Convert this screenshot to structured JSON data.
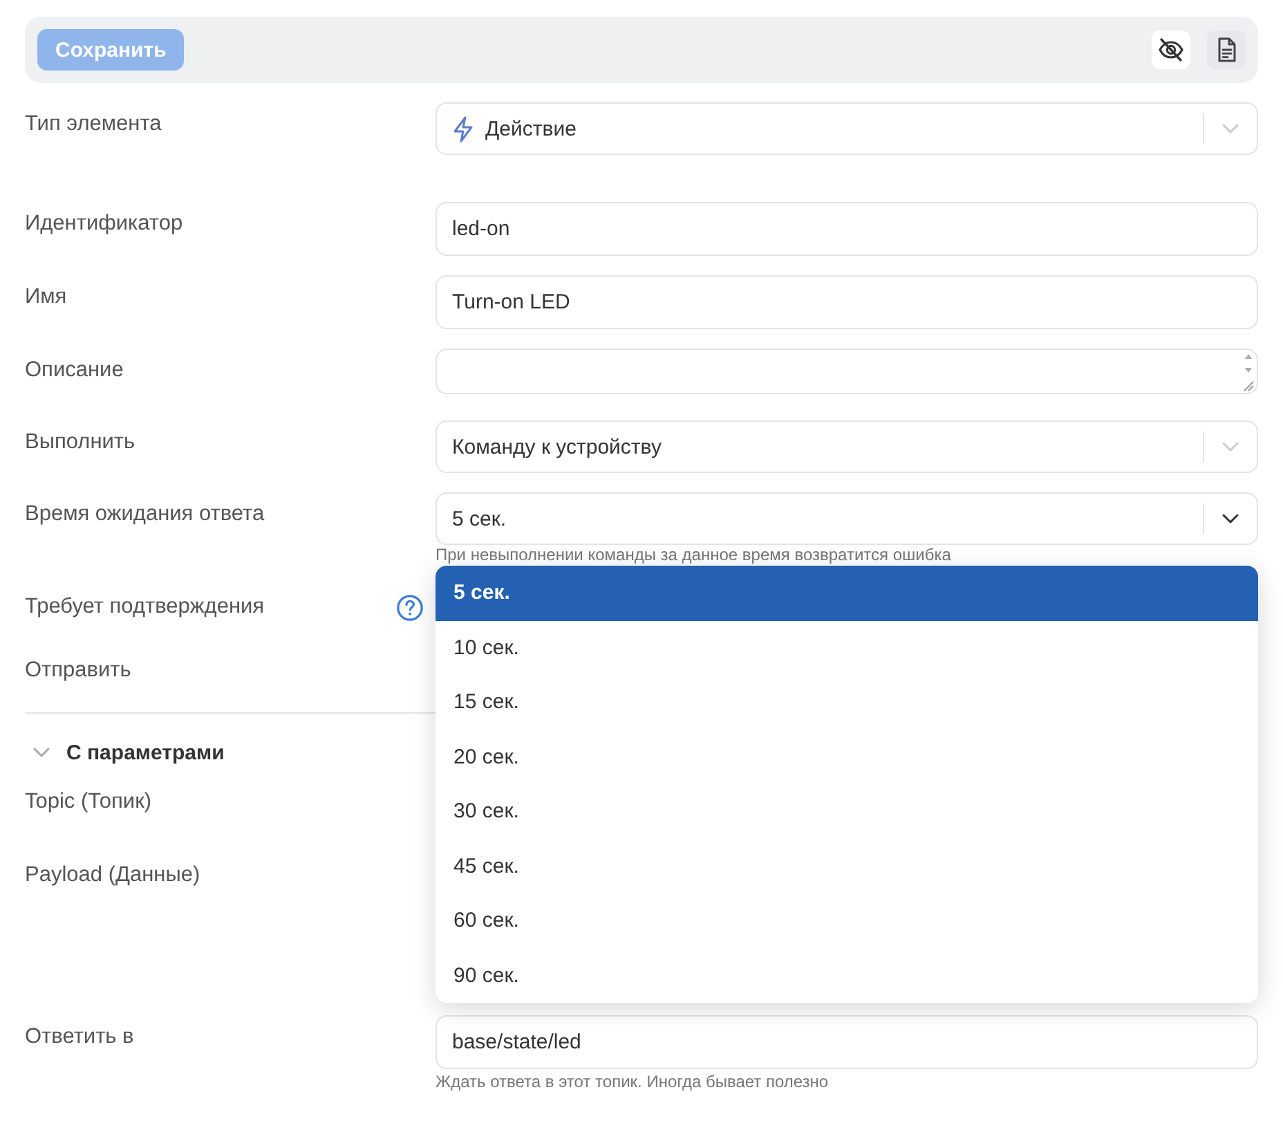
{
  "toolbar": {
    "save_button": {
      "label": "Сохранить",
      "disabled": true
    }
  },
  "fields": [
    {
      "kind": "type-select",
      "label": "Тип элемента",
      "value": "Действие",
      "expanded": false
    },
    {
      "kind": "input",
      "label": "Идентификатор",
      "value": "led-on"
    },
    {
      "kind": "input",
      "label": "Имя",
      "value": "Turn-on LED"
    },
    {
      "kind": "textarea",
      "label": "Описание"
    },
    {
      "kind": "select",
      "label": "Выполнить",
      "value": "Команду к устройству",
      "expanded": false
    },
    {
      "kind": "select",
      "label": "Время ожидания ответа",
      "value": "5 сек.",
      "expanded": true,
      "hint": "При невыполнении команды за данное время возвратится ошибка",
      "options": [
        {
          "label": "5 сек.",
          "selected": true
        },
        {
          "label": "10 сек.",
          "selected": false
        },
        {
          "label": "15 сек.",
          "selected": false
        },
        {
          "label": "20 сек.",
          "selected": false
        },
        {
          "label": "30 сек.",
          "selected": false
        },
        {
          "label": "45 сек.",
          "selected": false
        },
        {
          "label": "60 сек.",
          "selected": false
        },
        {
          "label": "90 сек.",
          "selected": false
        }
      ]
    },
    {
      "kind": "covered-help",
      "label": "Требует подтверждения"
    },
    {
      "kind": "covered-short",
      "label": "Отправить"
    },
    {
      "kind": "section",
      "label": "С параметрами",
      "expanded": true
    },
    {
      "kind": "covered-line",
      "label": "Topic (Топик)"
    },
    {
      "kind": "covered-tall",
      "label": "Payload (Данные)"
    },
    {
      "kind": "input",
      "label": "Ответить в",
      "value": "base/state/led",
      "hint": "Ждать ответа в этот топик. Иногда бывает полезно"
    }
  ]
}
